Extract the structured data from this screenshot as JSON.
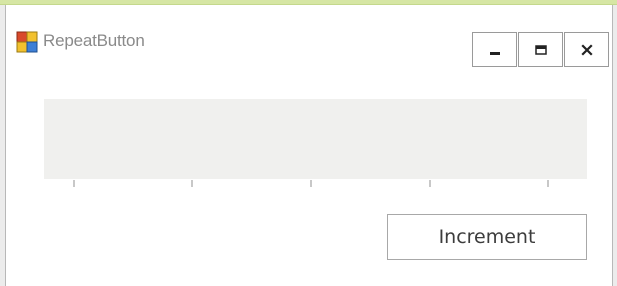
{
  "window": {
    "title": "RepeatButton",
    "app_icon": "windows-forms-app-icon",
    "caption_buttons": [
      {
        "name": "minimize",
        "icon": "minimize-icon"
      },
      {
        "name": "maximize",
        "icon": "maximize-icon"
      },
      {
        "name": "close",
        "icon": "close-icon"
      }
    ],
    "accent_color": "#d6e6a4"
  },
  "slider": {
    "value": 0,
    "tick_count": 5,
    "track_color": "#f0f0ee"
  },
  "increment_button": {
    "label": "Increment"
  }
}
